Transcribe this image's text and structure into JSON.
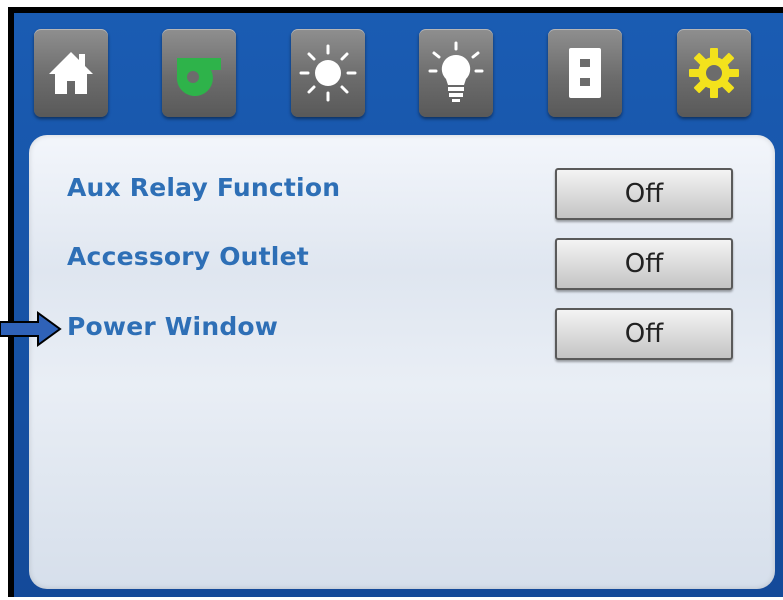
{
  "nav": {
    "items": [
      {
        "name": "home",
        "icon": "home-icon"
      },
      {
        "name": "blower",
        "icon": "fan-blower-icon",
        "color": "#2eb34a"
      },
      {
        "name": "light",
        "icon": "light-icon"
      },
      {
        "name": "bulb",
        "icon": "lightbulb-icon"
      },
      {
        "name": "outlet",
        "icon": "outlet-icon"
      },
      {
        "name": "settings",
        "icon": "gear-icon",
        "color": "#f3e21c"
      }
    ]
  },
  "settings": {
    "rows": [
      {
        "label": "Aux Relay Function",
        "value": "Off"
      },
      {
        "label": "Accessory Outlet",
        "value": "Off"
      },
      {
        "label": "Power Window",
        "value": "Off"
      }
    ]
  },
  "colors": {
    "frame": "#1752a6",
    "label": "#2e6fb6",
    "pointer": "#2f62b8"
  }
}
